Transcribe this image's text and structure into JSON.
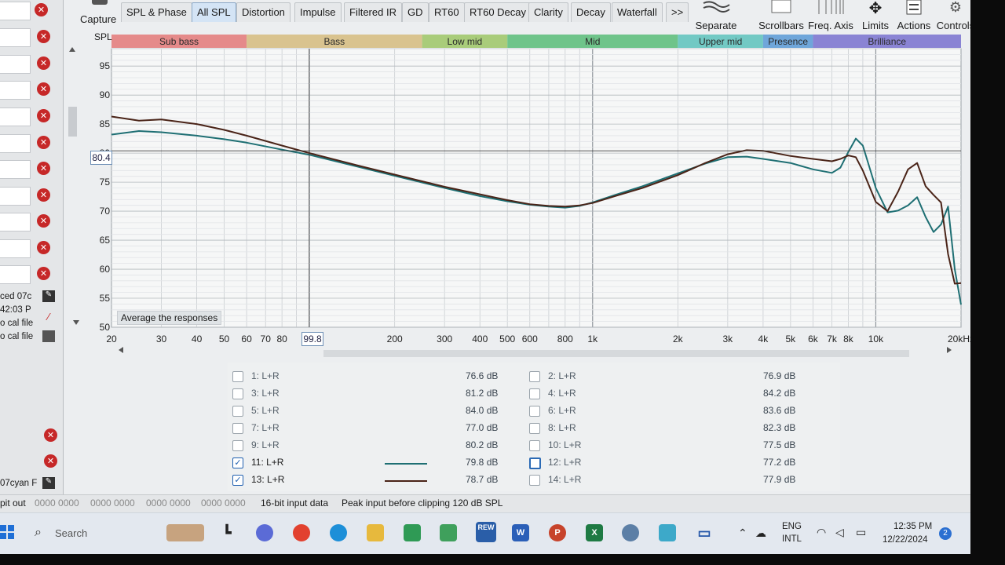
{
  "left_panel": {
    "partial_texts": [
      "ced 07c",
      "42:03 P",
      "o cal file",
      "o cal file",
      "07cyan F"
    ]
  },
  "toolbar": {
    "capture_label": "Capture",
    "tabs": [
      "SPL & Phase",
      "All SPL",
      "Distortion",
      "Impulse",
      "Filtered IR",
      "GD",
      "RT60",
      "RT60 Decay",
      "Clarity",
      "Decay",
      "Waterfall"
    ],
    "active_tab": "All SPL",
    "more_label": ">>",
    "right_buttons": [
      "Separate",
      "Scrollbars",
      "Freq. Axis",
      "Limits",
      "Actions",
      "Controls"
    ]
  },
  "graph": {
    "y_axis_title": "SPL",
    "y_ticks": [
      "95",
      "90",
      "85",
      "80",
      "75",
      "70",
      "65",
      "60",
      "55",
      "50"
    ],
    "x_ticks": [
      "20",
      "30",
      "40",
      "50",
      "60",
      "70",
      "80",
      "200",
      "300",
      "400",
      "500",
      "600",
      "800",
      "1k",
      "2k",
      "3k",
      "4k",
      "5k",
      "6k",
      "7k",
      "8k",
      "10k",
      "20kHz"
    ],
    "bands": [
      {
        "label": "Sub bass",
        "from": 20,
        "to": 60,
        "color": "#e58a8a"
      },
      {
        "label": "Bass",
        "from": 60,
        "to": 250,
        "color": "#d9c38f"
      },
      {
        "label": "Low mid",
        "from": 250,
        "to": 500,
        "color": "#a9cc7a"
      },
      {
        "label": "Mid",
        "from": 500,
        "to": 2000,
        "color": "#6fc48a"
      },
      {
        "label": "Upper mid",
        "from": 2000,
        "to": 4000,
        "color": "#72c9c4"
      },
      {
        "label": "Presence",
        "from": 4000,
        "to": 6000,
        "color": "#6fa6da"
      },
      {
        "label": "Brilliance",
        "from": 6000,
        "to": 20000,
        "color": "#8a84d4"
      }
    ],
    "cursor_spl": "80.4",
    "cursor_freq": "99.8",
    "average_button": "Average the responses"
  },
  "chart_data": {
    "type": "line",
    "x_scale": "log",
    "xlim": [
      20,
      20000
    ],
    "ylim": [
      50,
      98
    ],
    "ylabel": "SPL",
    "grid": true,
    "cursor": {
      "x": 99.8,
      "y": 80.4
    },
    "series": [
      {
        "name": "11: L+R",
        "color": "#1e6f73",
        "x": [
          20,
          25,
          30,
          40,
          50,
          60,
          80,
          100,
          150,
          200,
          300,
          400,
          500,
          600,
          700,
          800,
          900,
          1000,
          1200,
          1500,
          2000,
          2500,
          3000,
          3500,
          4000,
          5000,
          6000,
          7000,
          7500,
          8000,
          8500,
          9000,
          10000,
          11000,
          12000,
          13000,
          14000,
          15000,
          16000,
          17000,
          18000,
          19000,
          20000
        ],
        "y": [
          83.2,
          83.8,
          83.6,
          83.0,
          82.4,
          81.8,
          80.6,
          79.7,
          77.6,
          76.1,
          74.0,
          72.6,
          71.7,
          71.1,
          70.8,
          70.6,
          70.9,
          71.5,
          72.8,
          74.3,
          76.5,
          78.2,
          79.3,
          79.4,
          79.0,
          78.3,
          77.2,
          76.6,
          77.5,
          80.2,
          82.5,
          81.3,
          74.0,
          69.8,
          70.1,
          71.0,
          72.4,
          69.0,
          66.4,
          67.7,
          70.8,
          60.0,
          53.9
        ]
      },
      {
        "name": "13: L+R",
        "color": "#4a2418",
        "x": [
          20,
          25,
          30,
          40,
          50,
          60,
          80,
          100,
          150,
          200,
          300,
          400,
          500,
          600,
          700,
          800,
          900,
          1000,
          1200,
          1500,
          2000,
          2500,
          3000,
          3500,
          4000,
          5000,
          6000,
          7000,
          7500,
          8000,
          8500,
          9000,
          10000,
          11000,
          12000,
          13000,
          14000,
          15000,
          16000,
          17000,
          18000,
          19000,
          20000
        ],
        "y": [
          86.3,
          85.6,
          85.8,
          85.0,
          84.0,
          83.0,
          81.3,
          80.0,
          77.8,
          76.3,
          74.2,
          72.9,
          71.9,
          71.2,
          70.9,
          70.8,
          71.0,
          71.4,
          72.6,
          74.0,
          76.2,
          78.3,
          79.8,
          80.5,
          80.4,
          79.5,
          79.0,
          78.6,
          79.0,
          79.6,
          79.3,
          77.0,
          71.6,
          70.0,
          73.4,
          77.2,
          78.3,
          74.3,
          72.8,
          71.5,
          62.6,
          57.5,
          57.6
        ]
      }
    ]
  },
  "measurements": {
    "left": [
      {
        "name": "1: L+R",
        "db": "76.6 dB",
        "checked": false
      },
      {
        "name": "3: L+R",
        "db": "81.2 dB",
        "checked": false
      },
      {
        "name": "5: L+R",
        "db": "84.0 dB",
        "checked": false
      },
      {
        "name": "7: L+R",
        "db": "77.0 dB",
        "checked": false
      },
      {
        "name": "9: L+R",
        "db": "80.2 dB",
        "checked": false
      },
      {
        "name": "11: L+R",
        "db": "79.8 dB",
        "checked": true,
        "color": "#1e6f73"
      },
      {
        "name": "13: L+R",
        "db": "78.7 dB",
        "checked": true,
        "color": "#4a2418"
      }
    ],
    "right": [
      {
        "name": "2: L+R",
        "db": "76.9 dB"
      },
      {
        "name": "4: L+R",
        "db": "84.2 dB"
      },
      {
        "name": "6: L+R",
        "db": "83.6 dB"
      },
      {
        "name": "8: L+R",
        "db": "82.3 dB"
      },
      {
        "name": "10: L+R",
        "db": "77.5 dB"
      },
      {
        "name": "12: L+R",
        "db": "77.2 dB"
      },
      {
        "name": "14: L+R",
        "db": "77.9 dB"
      }
    ],
    "check_mark": "✓"
  },
  "status_bar": {
    "left_text": "pit out",
    "clip_indicators": [
      "0000 0000",
      "0000 0000",
      "0000 0000",
      "0000 0000"
    ],
    "input_format": "16-bit input data",
    "peak_input": "Peak input before clipping 120 dB SPL"
  },
  "taskbar": {
    "search_placeholder": "Search",
    "rew_label": "REW",
    "language": "ENG",
    "language_sub": "INTL",
    "time": "12:35 PM",
    "date": "12/22/2024",
    "notification_count": "2"
  }
}
